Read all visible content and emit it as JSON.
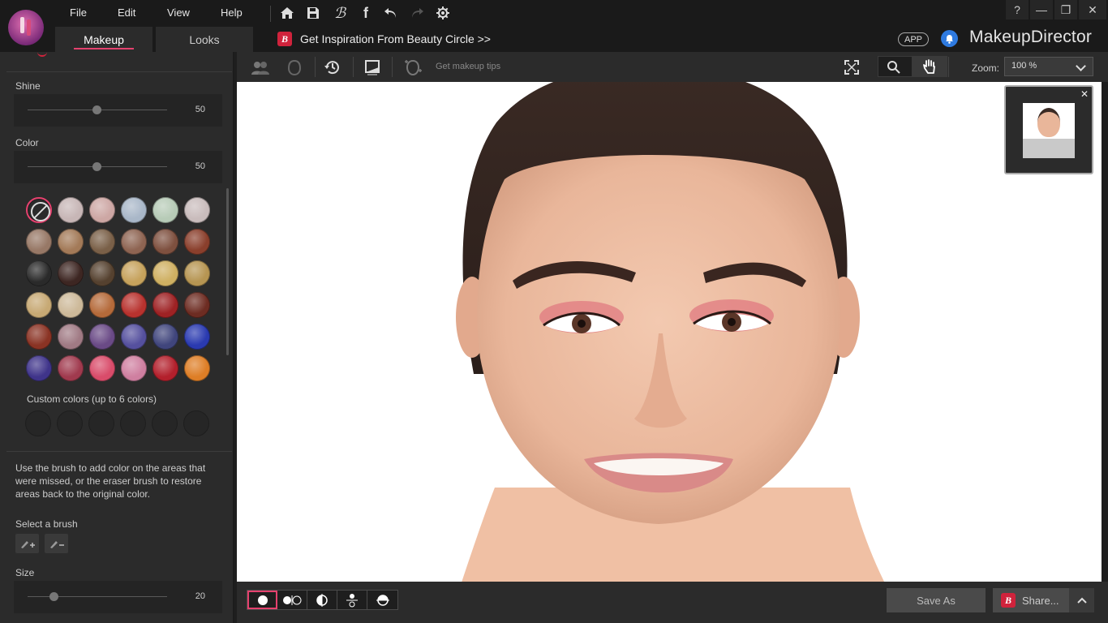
{
  "app": {
    "brand": "MakeupDirector",
    "app_badge": "APP"
  },
  "menu": [
    "File",
    "Edit",
    "View",
    "Help"
  ],
  "quick_icons": [
    "home-icon",
    "save-icon",
    "beauty-circle-icon",
    "facebook-icon",
    "undo-icon",
    "redo-icon",
    "settings-icon"
  ],
  "window_controls": {
    "help": "?",
    "minimize": "—",
    "restore": "❐",
    "close": "✕"
  },
  "tabs": {
    "makeup": "Makeup",
    "looks": "Looks"
  },
  "inspiration": {
    "logo": "B",
    "text": "Get Inspiration From Beauty Circle >>"
  },
  "left_panel": {
    "shine": {
      "label": "Shine",
      "value": "50"
    },
    "color": {
      "label": "Color",
      "value": "50"
    },
    "swatches": [
      [
        "none",
        "#c7b6b6",
        "#cda7a4",
        "#a9b7c8",
        "#b7cbb7",
        "#c9bcbc"
      ],
      [
        "#977866",
        "#a37a58",
        "#7a6048",
        "#8e6452",
        "#7e503f",
        "#8a3f2c"
      ],
      [
        "#2a2a2a",
        "#3d2622",
        "#55412f",
        "#c6a25c",
        "#cfb062",
        "#b69552"
      ],
      [
        "#c7a974",
        "#cdb999",
        "#b56a3a",
        "#b8322e",
        "#9e2224",
        "#6d2c22"
      ],
      [
        "#8a3324",
        "#a07a84",
        "#6a4a86",
        "#55509e",
        "#40457c",
        "#2a3ab0"
      ],
      [
        "#3f348a",
        "#a03a4e",
        "#d94c6a",
        "#cf7fa0",
        "#b3202c",
        "#de7e26"
      ]
    ],
    "custom_label": "Custom colors (up to 6 colors)",
    "help_text": "Use the brush to add color on the areas that were missed, or the eraser brush to restore areas back to the original color.",
    "brush_label": "Select a brush",
    "size": {
      "label": "Size",
      "value": "20"
    }
  },
  "toolbar": {
    "tips": "Get makeup tips",
    "zoom_label": "Zoom:",
    "zoom_value": "100 %"
  },
  "bottom": {
    "save_as": "Save As",
    "share": "Share...",
    "share_logo": "B"
  }
}
